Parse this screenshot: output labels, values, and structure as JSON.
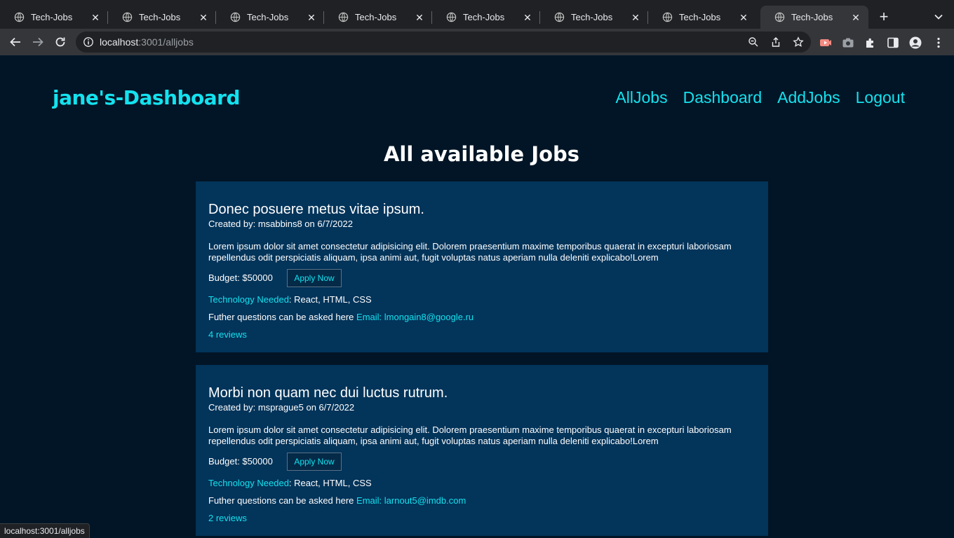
{
  "browser": {
    "tabs": [
      {
        "title": "Tech-Jobs"
      },
      {
        "title": "Tech-Jobs"
      },
      {
        "title": "Tech-Jobs"
      },
      {
        "title": "Tech-Jobs"
      },
      {
        "title": "Tech-Jobs"
      },
      {
        "title": "Tech-Jobs"
      },
      {
        "title": "Tech-Jobs"
      },
      {
        "title": "Tech-Jobs"
      }
    ],
    "active_tab_index": 7,
    "new_tab_label": "+",
    "close_label": "✕",
    "url_host": "localhost",
    "url_path": ":3001/alljobs",
    "status_url": "localhost:3001/alljobs"
  },
  "header": {
    "brand": "jane's-Dashboard",
    "nav": [
      "AllJobs",
      "Dashboard",
      "AddJobs",
      "Logout"
    ]
  },
  "main": {
    "heading": "All available Jobs",
    "jobs": [
      {
        "title": "Donec posuere metus vitae ipsum.",
        "created": "Created by: msabbins8 on 6/7/2022",
        "description": "Lorem ipsum dolor sit amet consectetur adipisicing elit. Dolorem praesentium maxime temporibus quaerat in excepturi laboriosam repellendus odit perspiciatis aliquam, ipsa animi aut, fugit voluptas natus aperiam nulla deleniti explicabo!Lorem",
        "budget": "Budget: $50000",
        "apply_label": "Apply Now",
        "tech_label": "Technology Needed",
        "tech_value": ": React, HTML, CSS",
        "questions_text": "Futher questions can be asked here ",
        "email": "Email: lmongain8@google.ru",
        "reviews": "4 reviews"
      },
      {
        "title": "Morbi non quam nec dui luctus rutrum.",
        "created": "Created by: msprague5 on 6/7/2022",
        "description": "Lorem ipsum dolor sit amet consectetur adipisicing elit. Dolorem praesentium maxime temporibus quaerat in excepturi laboriosam repellendus odit perspiciatis aliquam, ipsa animi aut, fugit voluptas natus aperiam nulla deleniti explicabo!Lorem",
        "budget": "Budget: $50000",
        "apply_label": "Apply Now",
        "tech_label": "Technology Needed",
        "tech_value": ": React, HTML, CSS",
        "questions_text": "Futher questions can be asked here ",
        "email": "Email: larnout5@imdb.com",
        "reviews": "2 reviews"
      }
    ]
  },
  "colors": {
    "page_bg": "#021526",
    "card_bg": "#03345a",
    "accent": "#14e2ef",
    "chrome_bg": "#202124",
    "toolbar_bg": "#35363a"
  },
  "icons": [
    "globe-icon",
    "close-icon",
    "plus-icon",
    "chevron-down-icon",
    "back-icon",
    "forward-icon",
    "reload-icon",
    "info-icon",
    "zoom-icon",
    "share-icon",
    "star-icon",
    "extension-icon",
    "camera-icon",
    "puzzle-icon",
    "sidepanel-icon",
    "profile-icon",
    "menu-icon"
  ]
}
